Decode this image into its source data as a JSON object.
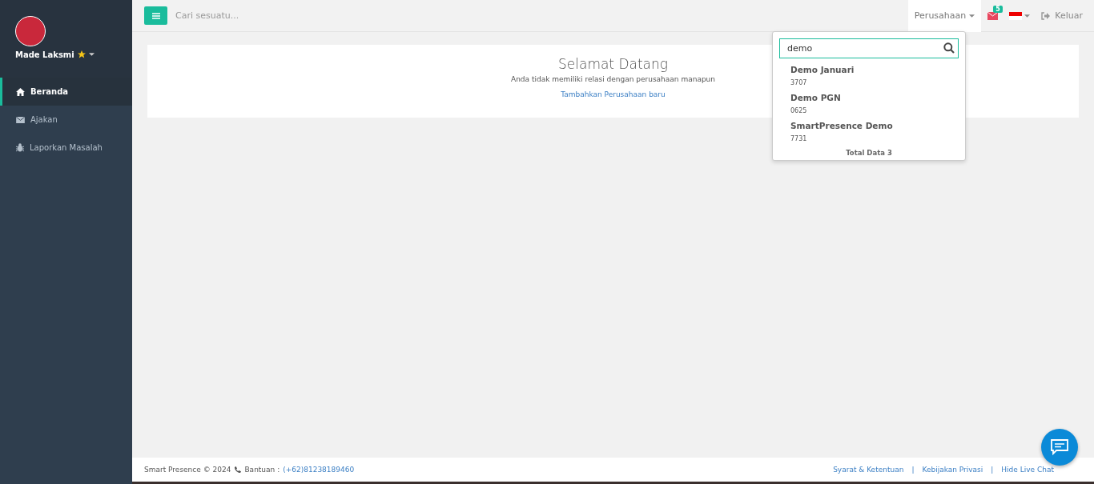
{
  "user": {
    "name": "Made Laksmi"
  },
  "sidebar": {
    "items": [
      {
        "label": "Beranda",
        "kind": "home",
        "selected": true
      },
      {
        "label": "Ajakan",
        "kind": "mail",
        "selected": false
      },
      {
        "label": "Laporkan Masalah",
        "kind": "bug",
        "selected": false
      }
    ]
  },
  "topbar": {
    "search": {
      "placeholder": "Cari sesuatu..."
    },
    "company_menu": {
      "label": "Perusahaan",
      "expanded": true
    },
    "mail_badge": "5",
    "logout": "Keluar"
  },
  "company_dropdown": {
    "search": {
      "value": "demo"
    },
    "results": [
      {
        "name": "Demo Januari",
        "code": "3707"
      },
      {
        "name": "Demo PGN",
        "code": "0625"
      },
      {
        "name": "SmartPresence Demo",
        "code": "7731"
      }
    ],
    "total": "Total Data 3"
  },
  "welcome": {
    "title": "Selamat Datang",
    "message": "Anda tidak memiliki relasi dengan perusahaan manapun",
    "link": "Tambahkan Perusahaan baru"
  },
  "footer": {
    "copyright": "Smart Presence © 2024",
    "help_label": "Bantuan :",
    "phone": "(+62)81238189460",
    "links": [
      {
        "kind": "link",
        "text": "Syarat & Ketentuan"
      },
      {
        "kind": "separator",
        "text": "|"
      },
      {
        "kind": "link",
        "text": "Kebijakan Privasi"
      },
      {
        "kind": "separator",
        "text": "|"
      },
      {
        "kind": "link",
        "text": "Hide Live Chat"
      }
    ]
  }
}
